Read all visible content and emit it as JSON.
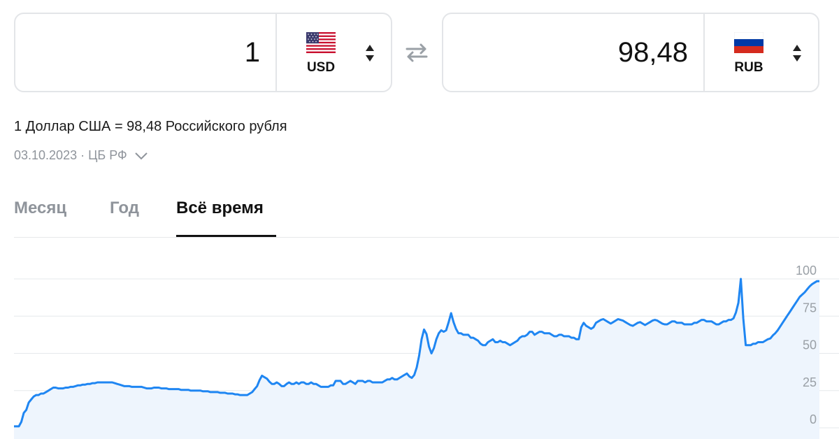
{
  "converter": {
    "from": {
      "amount": "1",
      "currency": "USD",
      "flag": "us-flag"
    },
    "to": {
      "amount": "98,48",
      "currency": "RUB",
      "flag": "ru-flag"
    }
  },
  "rate_text": "1 Доллар США = 98,48 Российского рубля",
  "rate_meta": "03.10.2023 · ЦБ РФ",
  "tabs": [
    {
      "label": "Месяц",
      "active": false
    },
    {
      "label": "Год",
      "active": false
    },
    {
      "label": "Всё время",
      "active": true
    }
  ],
  "colors": {
    "line": "#1f86f2",
    "area": "#eef5fd",
    "grid": "#e6e8eb",
    "active_tab": "#111111",
    "inactive": "#8f949b"
  },
  "chart_data": {
    "type": "area",
    "title": "",
    "xlabel": "",
    "ylabel": "",
    "ylim": [
      0,
      100
    ],
    "yticks": [
      "0",
      "25",
      "50",
      "75",
      "100"
    ],
    "grid": true,
    "series": [
      {
        "values": [
          1,
          1,
          1,
          4,
          10,
          12,
          17,
          19,
          21,
          22,
          22,
          23,
          23,
          24,
          25,
          26,
          27,
          27,
          26.5,
          26.5,
          26.5,
          27,
          27,
          27.5,
          27.5,
          28,
          28.5,
          28.5,
          29,
          29,
          29.5,
          29.5,
          30,
          30,
          30.5,
          30.5,
          30.5,
          30.5,
          30.5,
          30.5,
          30.5,
          30,
          29.5,
          29,
          28.5,
          28,
          28,
          28,
          27.5,
          27.5,
          27.5,
          27.5,
          27.5,
          27,
          26.5,
          26.5,
          26.5,
          27,
          27,
          27,
          26.5,
          26.5,
          26.5,
          26,
          26,
          26,
          26,
          26,
          25.5,
          25.5,
          25.5,
          25.5,
          25,
          25,
          25,
          25,
          25,
          24.5,
          24.5,
          24.5,
          24,
          24,
          24,
          24,
          23.5,
          23.5,
          23.5,
          23,
          23,
          23,
          22.5,
          22.5,
          22,
          22,
          22,
          22,
          23,
          24,
          26,
          28,
          32,
          35,
          34,
          33,
          31,
          29.5,
          29.5,
          30.5,
          29.5,
          28,
          28,
          29.5,
          30.5,
          29.5,
          29.5,
          30.5,
          29.5,
          30.5,
          30.5,
          29.5,
          29.5,
          30.5,
          29.5,
          29.5,
          28.5,
          27.5,
          27.5,
          27.5,
          27.5,
          28.5,
          28.5,
          31.5,
          31.5,
          31.5,
          29.5,
          29.5,
          30.5,
          31.5,
          30.5,
          29.5,
          31.5,
          31.5,
          31.5,
          30.5,
          31.5,
          31.5,
          30.5,
          30.5,
          30.5,
          30.5,
          30.5,
          31.5,
          32.5,
          32.5,
          33.5,
          32.5,
          32.5,
          33.5,
          34.5,
          35.5,
          36.5,
          34.5,
          33.5,
          35.5,
          40.5,
          48.5,
          59.5,
          66,
          63,
          54.5,
          50,
          53.5,
          59.5,
          63.5,
          65.5,
          64.5,
          65.5,
          71,
          77,
          71,
          66.5,
          63.5,
          63.5,
          62.5,
          62.5,
          62.5,
          60.5,
          60.5,
          59.5,
          58.5,
          56.5,
          55.5,
          55.5,
          57.5,
          58.5,
          59.5,
          57.5,
          57.5,
          58.5,
          57.5,
          57.5,
          56.5,
          55.5,
          56.5,
          57.5,
          58.5,
          60.5,
          61.5,
          61.5,
          62.5,
          64.5,
          64.5,
          62.5,
          63.5,
          64.5,
          64.5,
          63.5,
          63.5,
          63.5,
          62.5,
          61.5,
          61.5,
          62.5,
          62.5,
          61.5,
          61.5,
          61.5,
          60.5,
          60.5,
          59.5,
          59.5,
          67.5,
          70.5,
          68.5,
          67.5,
          66.5,
          67.5,
          70.5,
          71.5,
          72.5,
          73,
          72,
          71,
          70,
          71,
          72,
          73,
          72.5,
          72,
          71,
          70,
          69,
          68.5,
          69.5,
          70.5,
          71,
          70,
          69,
          70,
          71,
          72,
          72.5,
          72,
          71,
          70,
          69.5,
          69.5,
          70.5,
          71.5,
          71.5,
          70.5,
          70.5,
          70.5,
          69.5,
          69.5,
          69.5,
          69.5,
          70.5,
          70.5,
          71.5,
          72.5,
          72.5,
          71.5,
          71.5,
          71.5,
          70.5,
          69.5,
          69.5,
          70.5,
          71.5,
          71.5,
          72.5,
          72.5,
          73.5,
          77.5,
          84,
          100,
          73.5,
          55.5,
          55.5,
          55.5,
          56.5,
          56.5,
          57.5,
          57.5,
          57.5,
          58.5,
          59.5,
          60,
          62,
          63.5,
          65.5,
          68,
          70.5,
          73,
          75.5,
          78,
          80.5,
          83,
          85.5,
          88,
          89.5,
          91,
          93,
          95,
          96.5,
          97.5,
          98.5,
          98.5
        ]
      }
    ]
  }
}
